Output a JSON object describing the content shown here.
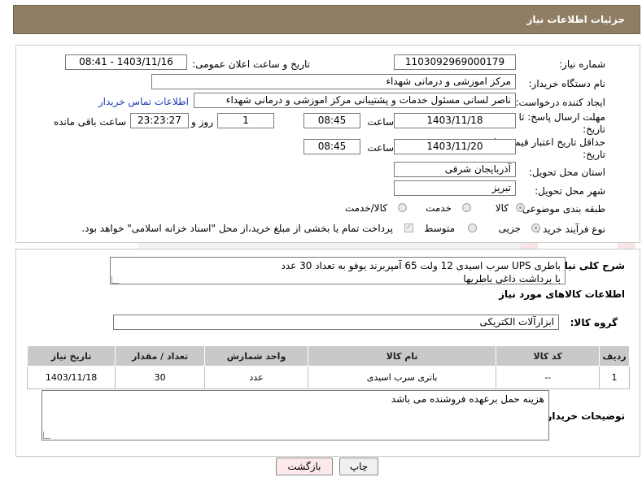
{
  "header": {
    "title": "جزئیات اطلاعات نیاز"
  },
  "form": {
    "need_number_label": "شماره نیاز:",
    "need_number": "1103092969000179",
    "announce_label": "تاریخ و ساعت اعلان عمومی:",
    "announce_value": "1403/11/16 - 08:41",
    "buyer_org_label": "نام دستگاه خریدار:",
    "buyer_org": "مرکز اموزشی و درمانی شهداء",
    "requester_label": "ایجاد کننده درخواست:",
    "requester": "ناصر لسانی مسئول خدمات و پشتیبانی مرکز اموزشی و درمانی شهداء",
    "buyer_contact_link": "اطلاعات تماس خریدار",
    "deadline_label_1": "مهلت ارسال پاسخ: تا",
    "deadline_label_2": "تاریخ:",
    "deadline_date": "1403/11/18",
    "time_label": "ساعت",
    "deadline_time": "08:45",
    "days_value": "1",
    "days_label": "روز و",
    "remaining_time": "23:23:27",
    "remaining_label": "ساعت باقی مانده",
    "validity_label_1": "حداقل تاریخ اعتبار قیمت: تا",
    "validity_label_2": "تاریخ:",
    "validity_date": "1403/11/20",
    "validity_time": "08:45",
    "province_label": "استان محل تحویل:",
    "province": "آذربایجان شرقی",
    "city_label": "شهر محل تحویل:",
    "city": "تبریز",
    "category_label": "طبقه بندی موضوعی:",
    "category_options": [
      "کالا",
      "خدمت",
      "کالا/خدمت"
    ],
    "purchase_type_label": "نوع فرآیند خرید :",
    "purchase_type_options": [
      "جزیی",
      "متوسط"
    ],
    "treasury_note": "پرداخت تمام یا بخشی از مبلغ خرید،از محل \"اسناد خزانه اسلامی\" خواهد بود."
  },
  "description": {
    "label": "شرح کلی نیاز:",
    "text": "باطری UPS سرب اسیدی 12 ولت 65 آمپربرند یوفو به تعداد 30 عدد\nبا برداشت داغی باطریها"
  },
  "goods_info": {
    "title": "اطلاعات کالاهای مورد نیاز",
    "group_label": "گروه کالا:",
    "group_value": "ابزارآلات الکتریکی",
    "columns": [
      "ردیف",
      "کد کالا",
      "نام کالا",
      "واحد شمارش",
      "تعداد / مقدار",
      "تاریخ نیاز"
    ],
    "rows": [
      {
        "row": "1",
        "code": "--",
        "name": "باتری سرب اسیدی",
        "unit": "عدد",
        "qty": "30",
        "date": "1403/11/18"
      }
    ]
  },
  "buyer_notes": {
    "label": "توضیحات خریدار:",
    "text": "هزینه حمل برعهده فروشنده می باشد"
  },
  "buttons": {
    "print": "چاپ",
    "back": "بازگشت"
  },
  "colors": {
    "header_bg": "#8f7e64",
    "link": "#1a3fb5",
    "back_button_bg": "#fde9e9"
  }
}
